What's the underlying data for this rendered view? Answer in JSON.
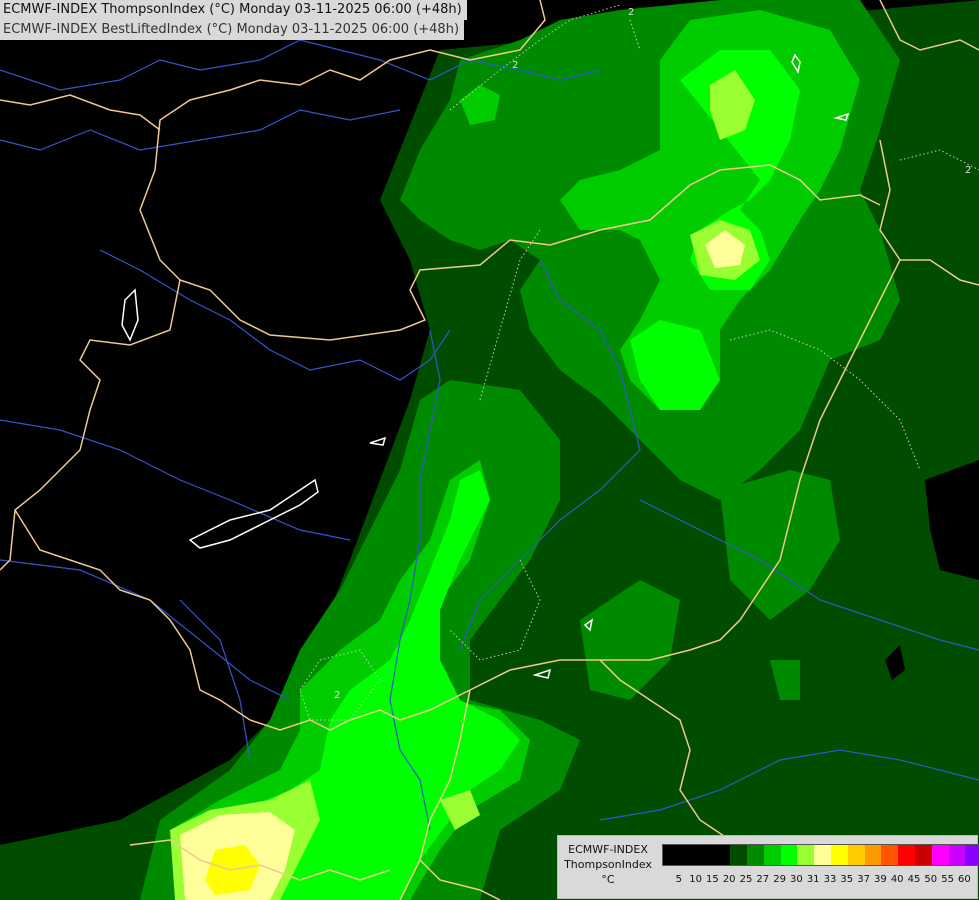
{
  "titles": {
    "line1": "ECMWF-INDEX ThompsonIndex (°C) Monday 03-11-2025 06:00 (+48h)",
    "line2": "ECMWF-INDEX BestLiftedIndex (°C) Monday 03-11-2025 06:00 (+48h)"
  },
  "contour_labels": [
    "2",
    "2",
    "2",
    "2"
  ],
  "legend": {
    "model": "ECMWF-INDEX",
    "parameter": "ThompsonIndex",
    "unit": "°C",
    "ticks": [
      "5",
      "10",
      "15",
      "20",
      "25",
      "27",
      "29",
      "30",
      "31",
      "33",
      "35",
      "37",
      "39",
      "40",
      "45",
      "50",
      "55",
      "60"
    ],
    "colors": [
      "#000000",
      "#000000",
      "#000000",
      "#000000",
      "#004d00",
      "#008a00",
      "#00cc00",
      "#00ff00",
      "#99ff33",
      "#ffff99",
      "#ffff00",
      "#ffcc00",
      "#ff9900",
      "#ff5500",
      "#ff0000",
      "#cc0000",
      "#ff00ff",
      "#cc00ff",
      "#8800ff",
      "#4400ff",
      "#0000ff"
    ]
  },
  "colors": {
    "background": "#000000",
    "level_dark": "#004d00",
    "level_mid": "#008a00",
    "level_bright": "#00cc00",
    "level_lime": "#00ff00",
    "level_yellowgreen": "#99ff33",
    "level_paleyellow": "#ffff99",
    "level_yellow": "#ffff00",
    "borders": "#f0c890",
    "rivers": "#3355cc",
    "lakes": "#ffffff"
  }
}
